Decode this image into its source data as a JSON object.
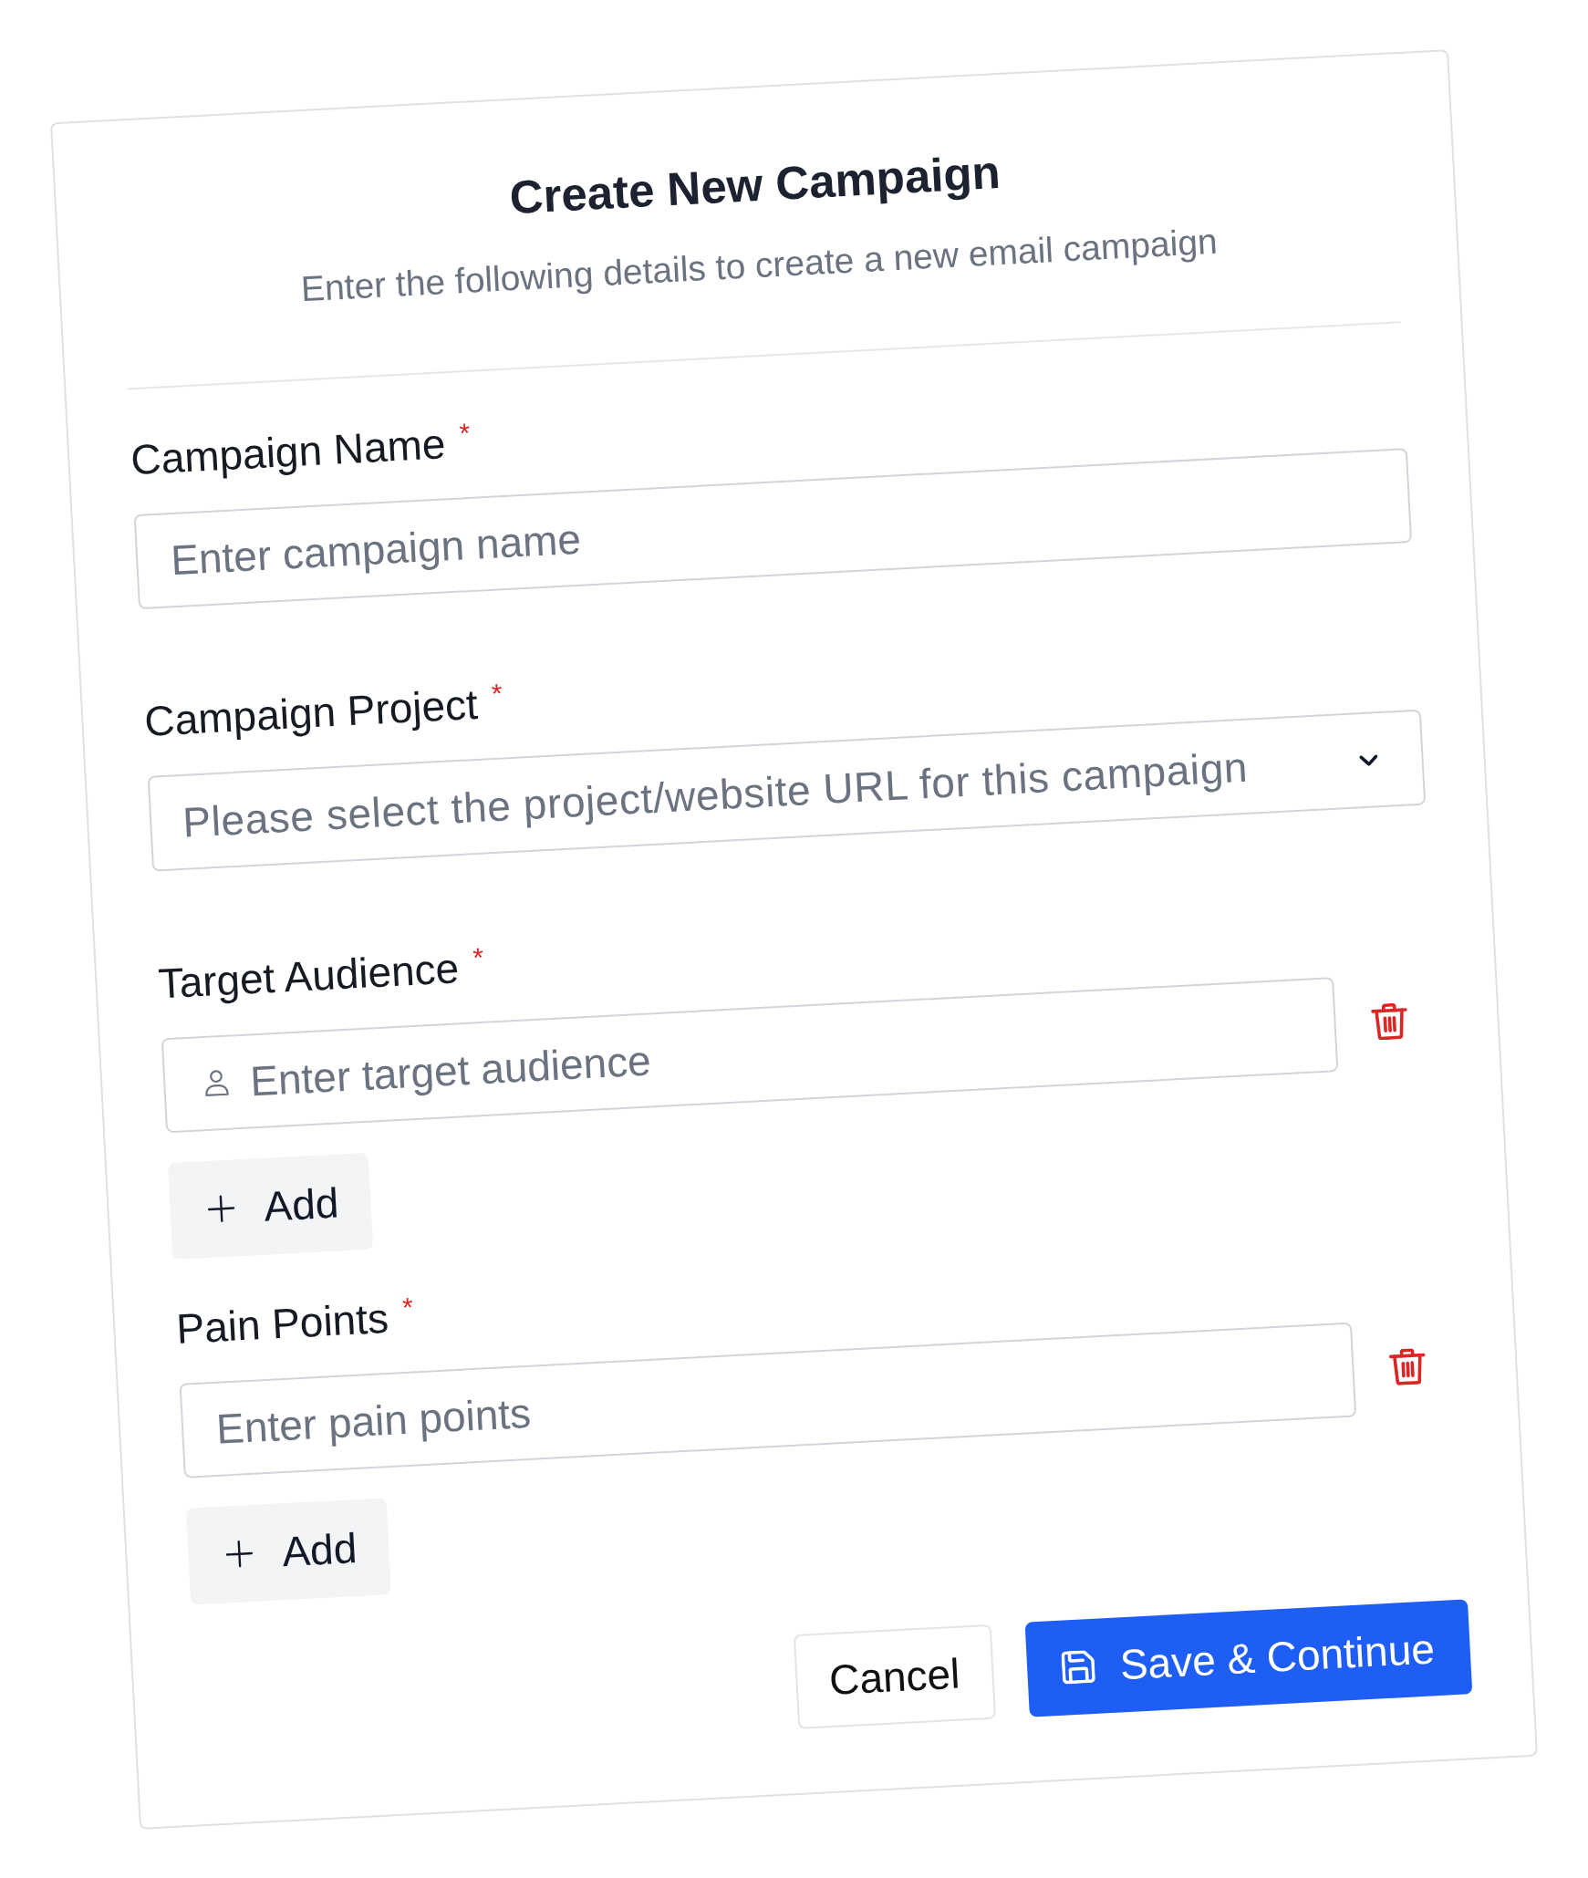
{
  "dialog": {
    "title": "Create New Campaign",
    "subtitle": "Enter the following details to create a new email campaign"
  },
  "fields": [
    {
      "kind": "text",
      "label": "Campaign Name",
      "required_mark": "*",
      "placeholder": "Enter campaign name"
    },
    {
      "kind": "select",
      "label": "Campaign Project",
      "required_mark": "*",
      "placeholder": "Please select the project/website URL for this campaign"
    },
    {
      "kind": "repeatable",
      "label": "Target Audience",
      "required_mark": "*",
      "placeholder": "Enter target audience",
      "leading_icon": true,
      "add_label": "Add"
    },
    {
      "kind": "repeatable",
      "label": "Pain Points",
      "required_mark": "*",
      "placeholder": "Enter pain points",
      "leading_icon": false,
      "add_label": "Add"
    }
  ],
  "buttons": [
    {
      "kind": "secondary",
      "label": "Cancel"
    },
    {
      "kind": "primary",
      "label": "Save & Continue"
    }
  ]
}
